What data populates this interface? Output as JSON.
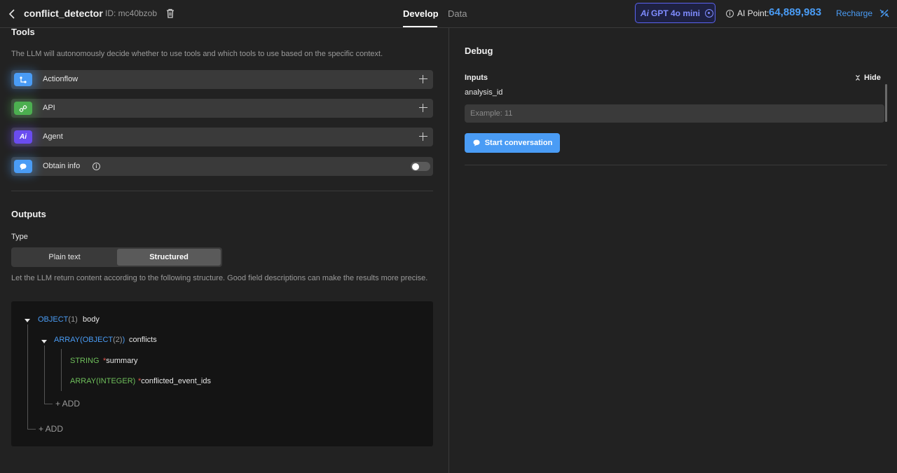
{
  "header": {
    "title": "conflict_detector",
    "id_text": "ID: mc40bzob",
    "tabs": [
      {
        "label": "Develop",
        "active": true
      },
      {
        "label": "Data",
        "active": false
      }
    ],
    "model": {
      "label": "GPT 4o mini",
      "icon": "ai-logo-icon"
    },
    "ai_point_label": "AI Point:",
    "ai_point_value": "64,889,983",
    "recharge_label": "Recharge"
  },
  "tools": {
    "title": "Tools",
    "description": "The LLM will autonomously decide whether to use tools and which tools to use based on the specific context.",
    "items": [
      {
        "label": "Actionflow",
        "icon": "actionflow-icon",
        "color": "#4a9cf5",
        "action": "add"
      },
      {
        "label": "API",
        "icon": "api-link-icon",
        "color": "#4caf50",
        "action": "add"
      },
      {
        "label": "Agent",
        "icon": "agent-ai-icon",
        "color": "#6a4cf0",
        "action": "add"
      },
      {
        "label": "Obtain info",
        "icon": "chat-bubble-icon",
        "color": "#4a9cf5",
        "action": "toggle",
        "enabled": false
      }
    ]
  },
  "outputs": {
    "title": "Outputs",
    "type_label": "Type",
    "type_options": [
      "Plain text",
      "Structured"
    ],
    "selected": "Structured",
    "description": "Let the LLM return content according to the following structure. Good field descriptions can make the results more precise.",
    "schema": {
      "root": {
        "type": "OBJECT",
        "count": "(1)",
        "name": "body"
      },
      "array": {
        "type": "ARRAY(OBJECT",
        "count": "(2)",
        "close": ")",
        "name": "conflicts"
      },
      "fields": [
        {
          "type": "STRING",
          "required": "*",
          "name": "summary"
        },
        {
          "type": "ARRAY(INTEGER)",
          "required": "*",
          "name": "conflicted_event_ids"
        }
      ],
      "add_label": "+ ADD"
    }
  },
  "debug": {
    "title": "Debug",
    "inputs_title": "Inputs",
    "hide_label": "Hide",
    "field_label": "analysis_id",
    "field_placeholder": "Example: 11",
    "field_value": "",
    "start_label": "Start conversation"
  },
  "colors": {
    "accent": "#4a9cf5",
    "model_accent": "#7f8cff",
    "string_type": "#6fbf5b",
    "required": "#e0554d"
  }
}
